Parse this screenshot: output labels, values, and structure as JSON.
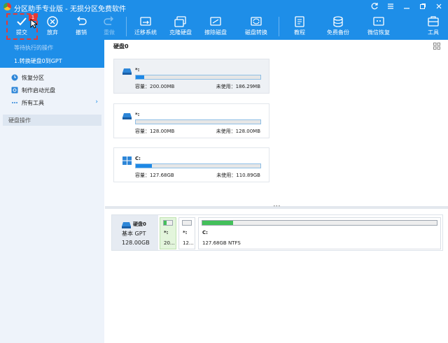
{
  "window": {
    "title": "分区助手专业版 - 无损分区免费软件",
    "controls": [
      "minimize",
      "maximize",
      "close"
    ]
  },
  "toolbar": {
    "items": [
      {
        "label": "提交",
        "icon": "check-icon",
        "disabled": false
      },
      {
        "label": "放弃",
        "icon": "cancel-circle-icon",
        "disabled": false
      },
      {
        "label": "撤销",
        "icon": "undo-icon",
        "disabled": false
      },
      {
        "label": "重做",
        "icon": "redo-icon",
        "disabled": true
      },
      {
        "label": "迁移系统",
        "icon": "migrate-os-icon",
        "disabled": false
      },
      {
        "label": "克隆硬盘",
        "icon": "clone-disk-icon",
        "disabled": false
      },
      {
        "label": "擦除磁盘",
        "icon": "wipe-disk-icon",
        "disabled": false
      },
      {
        "label": "磁盘转换",
        "icon": "convert-disk-icon",
        "disabled": false
      },
      {
        "label": "教程",
        "icon": "tutorial-icon",
        "disabled": false
      },
      {
        "label": "免费备份",
        "icon": "backup-icon",
        "disabled": false
      },
      {
        "label": "微信恢复",
        "icon": "wechat-recovery-icon",
        "disabled": false
      },
      {
        "label": "工具",
        "icon": "tools-icon",
        "disabled": false
      }
    ],
    "submit_badge": "1"
  },
  "sidebar": {
    "pending_title": "等待执行的操作",
    "pending_op": "1.转换硬盘0到GPT",
    "items": [
      {
        "label": "恢复分区",
        "icon": "recover-partition-icon"
      },
      {
        "label": "制作启动光盘",
        "icon": "boot-disc-icon"
      },
      {
        "label": "所有工具",
        "icon": "more-icon"
      }
    ],
    "section": "硬盘操作"
  },
  "main": {
    "title": "硬盘0",
    "disks": [
      {
        "name": "*:",
        "capacity": "容量：200.00MB",
        "free": "未使用：186.29MB",
        "used_fraction": 0.07,
        "selected": true,
        "os_icon": false
      },
      {
        "name": "*:",
        "capacity": "容量：128.00MB",
        "free": "未使用：128.00MB",
        "used_fraction": 0.0,
        "selected": false,
        "os_icon": false
      },
      {
        "name": "C:",
        "capacity": "容量：127.68GB",
        "free": "未使用：110.89GB",
        "used_fraction": 0.13,
        "selected": false,
        "os_icon": true
      }
    ],
    "disk_map": {
      "disk_label": "硬盘0",
      "type": "基本 GPT",
      "size": "128.00GB",
      "partitions": [
        {
          "label": "*:",
          "size": "20...",
          "used_fraction": 0.35,
          "selected": true
        },
        {
          "label": "*:",
          "size": "12...",
          "used_fraction": 0.0,
          "selected": false
        },
        {
          "label": "C:",
          "size": "127.68GB NTFS",
          "used_fraction": 0.13,
          "selected": false
        }
      ]
    }
  },
  "colors": {
    "accent": "#1e8ee8",
    "highlight": "#e53935",
    "partition_used": "#43c05a",
    "bar_fill": "#1e88e5"
  }
}
